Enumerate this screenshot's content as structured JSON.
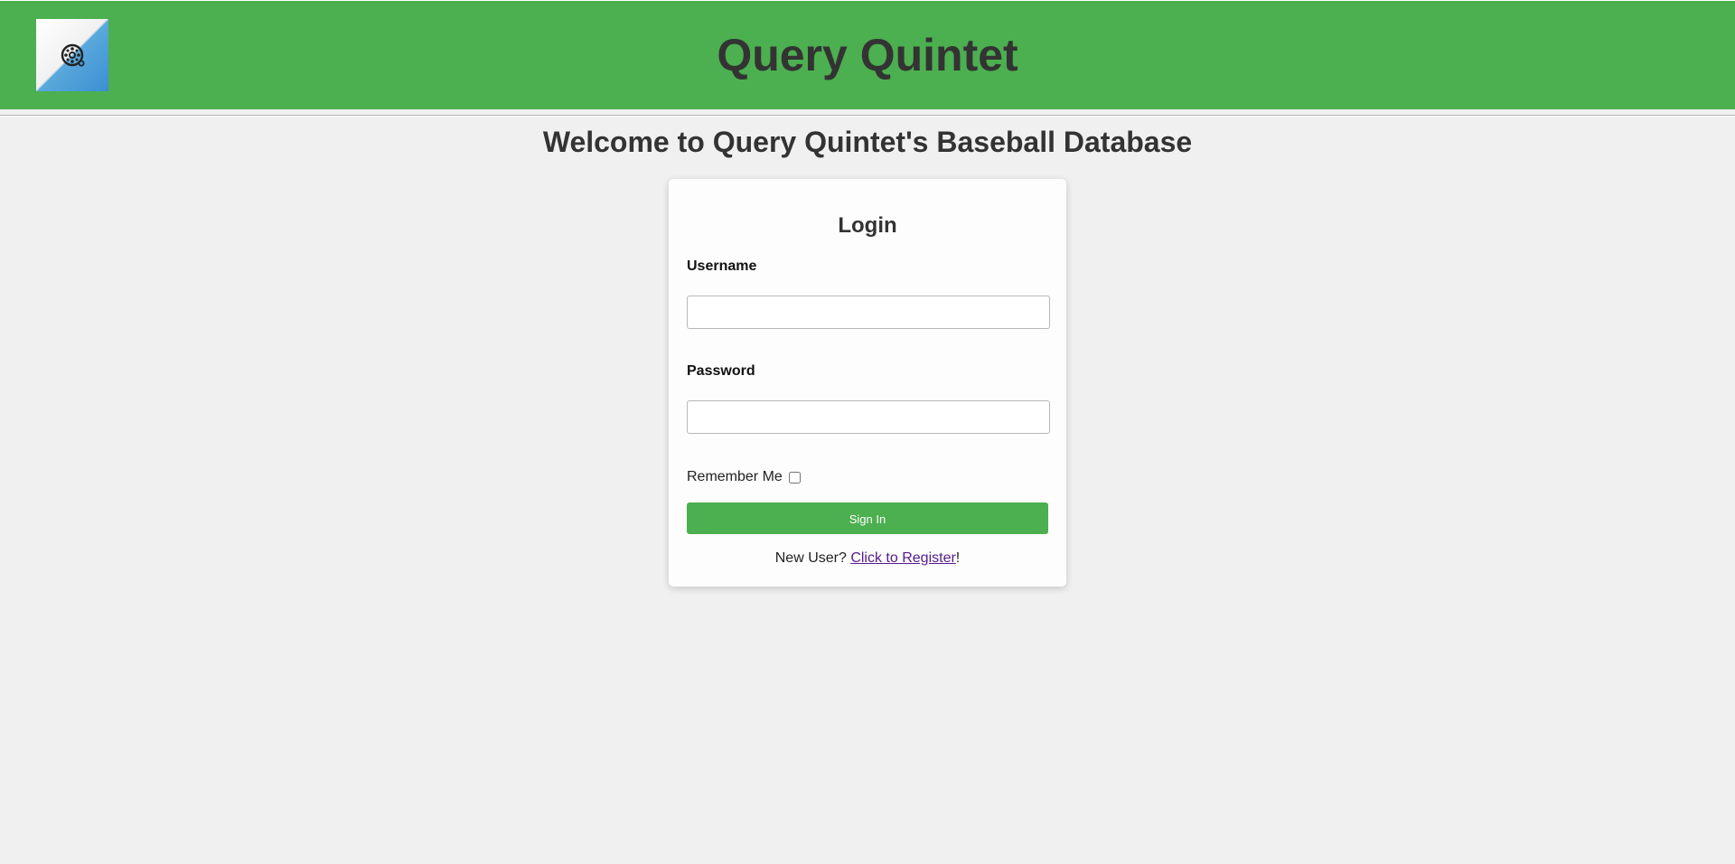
{
  "header": {
    "title": "Query Quintet",
    "logo_icon": "baseball-film-reel-icon"
  },
  "welcome": "Welcome to Query Quintet's Baseball Database",
  "login": {
    "title": "Login",
    "username_label": "Username",
    "username_value": "",
    "password_label": "Password",
    "password_value": "",
    "remember_label": "Remember Me",
    "remember_checked": false,
    "signin_label": "Sign In",
    "new_user_text": "New User? ",
    "register_link": "Click to Register",
    "register_suffix": "!"
  },
  "colors": {
    "header_bg": "#4caf50",
    "page_bg": "#f0f0f0",
    "button_bg": "#4caf50",
    "link_color": "#551a8b"
  }
}
